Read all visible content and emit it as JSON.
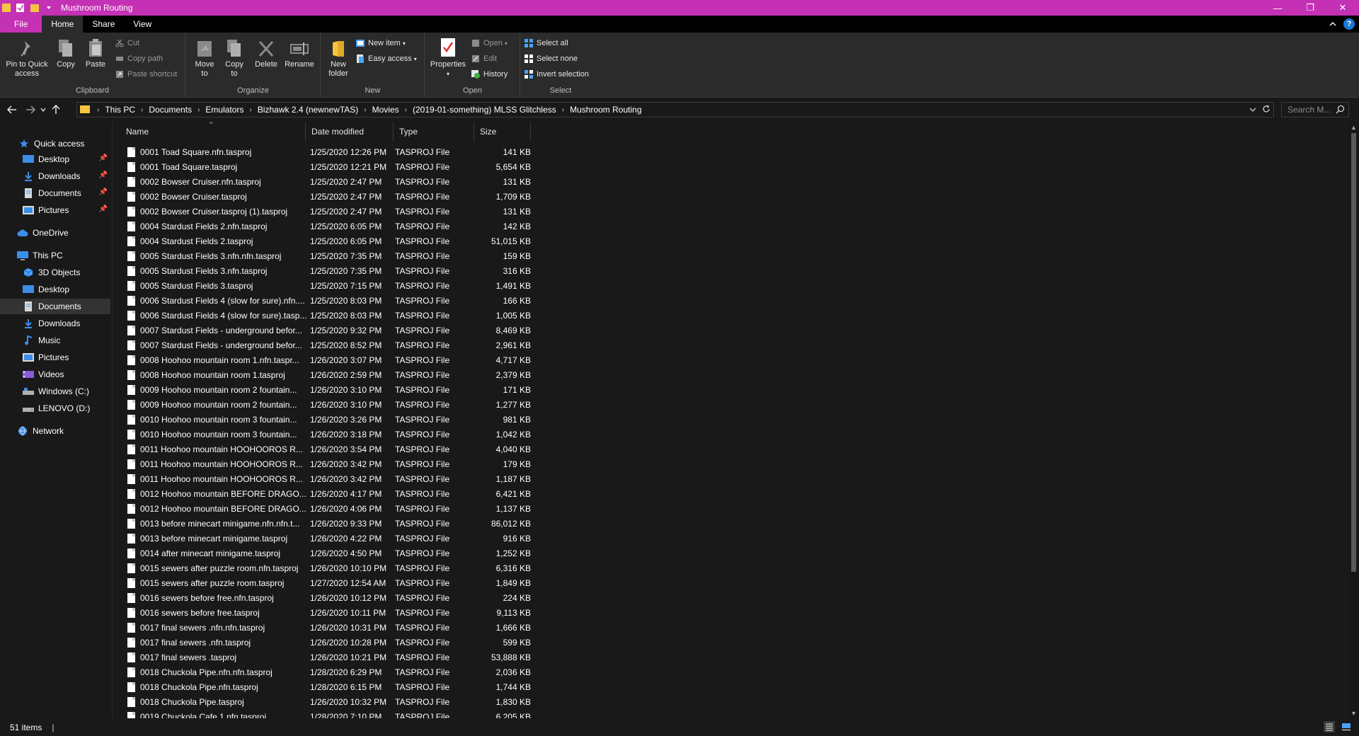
{
  "window": {
    "title": "Mushroom Routing",
    "titlebar_color": "#c431b5",
    "minimize": "—",
    "maximize": "❐",
    "close": "✕"
  },
  "ribbon_tabs": [
    "File",
    "Home",
    "Share",
    "View"
  ],
  "ribbon": {
    "clipboard": {
      "pin": "Pin to Quick access",
      "copy": "Copy",
      "paste": "Paste",
      "cut": "Cut",
      "copy_path": "Copy path",
      "paste_shortcut": "Paste shortcut",
      "label": "Clipboard"
    },
    "organize": {
      "move_to": "Move to",
      "copy_to": "Copy to",
      "delete": "Delete",
      "rename": "Rename",
      "label": "Organize"
    },
    "new": {
      "new_folder": "New folder",
      "new_item": "New item",
      "easy_access": "Easy access",
      "label": "New"
    },
    "open": {
      "properties": "Properties",
      "open": "Open",
      "edit": "Edit",
      "history": "History",
      "label": "Open"
    },
    "select": {
      "select_all": "Select all",
      "select_none": "Select none",
      "invert": "Invert selection",
      "label": "Select"
    }
  },
  "breadcrumb": [
    "This PC",
    "Documents",
    "Emulators",
    "Bizhawk 2.4 (newnewTAS)",
    "Movies",
    "(2019-01-something) MLSS Glitchless",
    "Mushroom Routing"
  ],
  "search": {
    "placeholder": "Search M..."
  },
  "nav": {
    "quick_access": "Quick access",
    "qa_desktop": "Desktop",
    "qa_downloads": "Downloads",
    "qa_documents": "Documents",
    "qa_pictures": "Pictures",
    "onedrive": "OneDrive",
    "this_pc": "This PC",
    "objects3d": "3D Objects",
    "desktop": "Desktop",
    "documents": "Documents",
    "downloads": "Downloads",
    "music": "Music",
    "pictures": "Pictures",
    "videos": "Videos",
    "windows_c": "Windows (C:)",
    "lenovo_d": "LENOVO (D:)",
    "network": "Network"
  },
  "columns": {
    "name": "Name",
    "date": "Date modified",
    "type": "Type",
    "size": "Size"
  },
  "files": [
    [
      "0001 Toad Square.nfn.tasproj",
      "1/25/2020 12:26 PM",
      "TASPROJ File",
      "141 KB"
    ],
    [
      "0001 Toad Square.tasproj",
      "1/25/2020 12:21 PM",
      "TASPROJ File",
      "5,654 KB"
    ],
    [
      "0002 Bowser Cruiser.nfn.tasproj",
      "1/25/2020 2:47 PM",
      "TASPROJ File",
      "131 KB"
    ],
    [
      "0002 Bowser Cruiser.tasproj",
      "1/25/2020 2:47 PM",
      "TASPROJ File",
      "1,709 KB"
    ],
    [
      "0002 Bowser Cruiser.tasproj (1).tasproj",
      "1/25/2020 2:47 PM",
      "TASPROJ File",
      "131 KB"
    ],
    [
      "0004 Stardust Fields 2.nfn.tasproj",
      "1/25/2020 6:05 PM",
      "TASPROJ File",
      "142 KB"
    ],
    [
      "0004 Stardust Fields 2.tasproj",
      "1/25/2020 6:05 PM",
      "TASPROJ File",
      "51,015 KB"
    ],
    [
      "0005 Stardust Fields 3.nfn.nfn.tasproj",
      "1/25/2020 7:35 PM",
      "TASPROJ File",
      "159 KB"
    ],
    [
      "0005 Stardust Fields 3.nfn.tasproj",
      "1/25/2020 7:35 PM",
      "TASPROJ File",
      "316 KB"
    ],
    [
      "0005 Stardust Fields 3.tasproj",
      "1/25/2020 7:15 PM",
      "TASPROJ File",
      "1,491 KB"
    ],
    [
      "0006 Stardust Fields 4 (slow for sure).nfn....",
      "1/25/2020 8:03 PM",
      "TASPROJ File",
      "166 KB"
    ],
    [
      "0006 Stardust Fields 4 (slow for sure).tasp...",
      "1/25/2020 8:03 PM",
      "TASPROJ File",
      "1,005 KB"
    ],
    [
      "0007 Stardust Fields - underground befor...",
      "1/25/2020 9:32 PM",
      "TASPROJ File",
      "8,469 KB"
    ],
    [
      "0007 Stardust Fields - underground befor...",
      "1/25/2020 8:52 PM",
      "TASPROJ File",
      "2,961 KB"
    ],
    [
      "0008 Hoohoo mountain room 1.nfn.taspr...",
      "1/26/2020 3:07 PM",
      "TASPROJ File",
      "4,717 KB"
    ],
    [
      "0008 Hoohoo mountain room 1.tasproj",
      "1/26/2020 2:59 PM",
      "TASPROJ File",
      "2,379 KB"
    ],
    [
      "0009 Hoohoo mountain room 2 fountain...",
      "1/26/2020 3:10 PM",
      "TASPROJ File",
      "171 KB"
    ],
    [
      "0009 Hoohoo mountain room 2 fountain...",
      "1/26/2020 3:10 PM",
      "TASPROJ File",
      "1,277 KB"
    ],
    [
      "0010 Hoohoo mountain room 3 fountain...",
      "1/26/2020 3:26 PM",
      "TASPROJ File",
      "981 KB"
    ],
    [
      "0010 Hoohoo mountain room 3 fountain...",
      "1/26/2020 3:18 PM",
      "TASPROJ File",
      "1,042 KB"
    ],
    [
      "0011 Hoohoo mountain HOOHOOROS R...",
      "1/26/2020 3:54 PM",
      "TASPROJ File",
      "4,040 KB"
    ],
    [
      "0011 Hoohoo mountain HOOHOOROS R...",
      "1/26/2020 3:42 PM",
      "TASPROJ File",
      "179 KB"
    ],
    [
      "0011 Hoohoo mountain HOOHOOROS R...",
      "1/26/2020 3:42 PM",
      "TASPROJ File",
      "1,187 KB"
    ],
    [
      "0012 Hoohoo mountain BEFORE DRAGO...",
      "1/26/2020 4:17 PM",
      "TASPROJ File",
      "6,421 KB"
    ],
    [
      "0012 Hoohoo mountain BEFORE DRAGO...",
      "1/26/2020 4:06 PM",
      "TASPROJ File",
      "1,137 KB"
    ],
    [
      "0013 before minecart minigame.nfn.nfn.t...",
      "1/26/2020 9:33 PM",
      "TASPROJ File",
      "86,012 KB"
    ],
    [
      "0013 before minecart minigame.tasproj",
      "1/26/2020 4:22 PM",
      "TASPROJ File",
      "916 KB"
    ],
    [
      "0014 after minecart minigame.tasproj",
      "1/26/2020 4:50 PM",
      "TASPROJ File",
      "1,252 KB"
    ],
    [
      "0015 sewers after puzzle room.nfn.tasproj",
      "1/26/2020 10:10 PM",
      "TASPROJ File",
      "6,316 KB"
    ],
    [
      "0015 sewers after puzzle room.tasproj",
      "1/27/2020 12:54 AM",
      "TASPROJ File",
      "1,849 KB"
    ],
    [
      "0016 sewers before free.nfn.tasproj",
      "1/26/2020 10:12 PM",
      "TASPROJ File",
      "224 KB"
    ],
    [
      "0016 sewers before free.tasproj",
      "1/26/2020 10:11 PM",
      "TASPROJ File",
      "9,113 KB"
    ],
    [
      "0017 final sewers .nfn.nfn.tasproj",
      "1/26/2020 10:31 PM",
      "TASPROJ File",
      "1,666 KB"
    ],
    [
      "0017 final sewers .nfn.tasproj",
      "1/26/2020 10:28 PM",
      "TASPROJ File",
      "599 KB"
    ],
    [
      "0017 final sewers .tasproj",
      "1/26/2020 10:21 PM",
      "TASPROJ File",
      "53,888 KB"
    ],
    [
      "0018 Chuckola Pipe.nfn.nfn.tasproj",
      "1/28/2020 6:29 PM",
      "TASPROJ File",
      "2,036 KB"
    ],
    [
      "0018 Chuckola Pipe.nfn.tasproj",
      "1/28/2020 6:15 PM",
      "TASPROJ File",
      "1,744 KB"
    ],
    [
      "0018 Chuckola Pipe.tasproj",
      "1/26/2020 10:32 PM",
      "TASPROJ File",
      "1,830 KB"
    ],
    [
      "0019 Chuckola Cafe 1.nfn.tasproj",
      "1/28/2020 7:10 PM",
      "TASPROJ File",
      "6,205 KB"
    ]
  ],
  "status": {
    "count": "51 items",
    "sep": "|"
  }
}
